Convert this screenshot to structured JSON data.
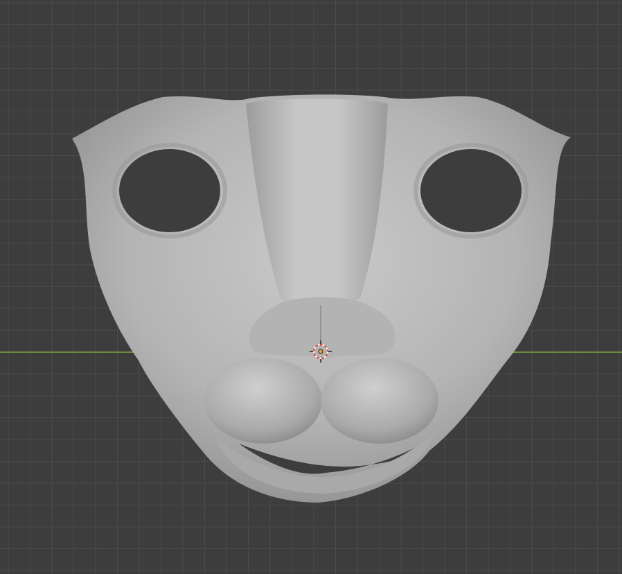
{
  "viewport": {
    "background_color": "#3d3d3d",
    "grid_color": "#4a4a4a",
    "x_axis_color": "#7fa836",
    "mesh_color": "#b8b8b8",
    "object": "cat-face-mask",
    "cursor": "3d-cursor-icon"
  }
}
